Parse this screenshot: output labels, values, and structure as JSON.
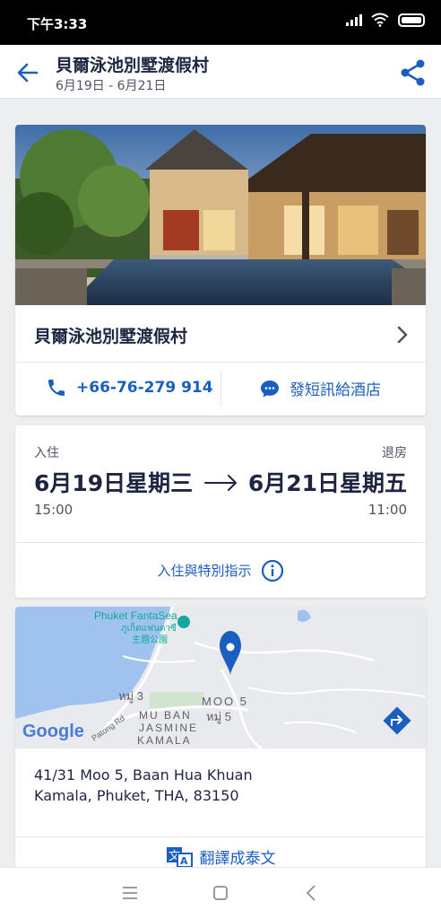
{
  "status_bar": {
    "time": "下午3:33"
  },
  "app_bar": {
    "title": "貝爾泳池別墅渡假村",
    "dates": "6月19日 - 6月21日"
  },
  "hotel": {
    "name": "貝爾泳池別墅渡假村",
    "phone": "+66-76-279 914",
    "sms_label": "發短訊給酒店"
  },
  "stay": {
    "checkin_label": "入住",
    "checkout_label": "退房",
    "checkin_date": "6月19日星期三",
    "checkout_date": "6月21日星期五",
    "checkin_time": "15:00",
    "checkout_time": "11:00",
    "instructions_label": "入住與特別指示"
  },
  "map": {
    "poi_name": "Phuket FantaSea",
    "poi_thai_1": "ภูเก็ตแฟนตาซี",
    "poi_thai_2": "主題公園",
    "label_moo3": "หมู่ 3",
    "label_moo5": "MOO 5",
    "label_moo5_thai": "หมู่ 5",
    "label_muban_1": "MU BAN",
    "label_muban_2": "JASMINE",
    "label_muban_3": "KAMALA",
    "road_label": "Patong Rd",
    "logo_text": "Google"
  },
  "address": {
    "line1": "41/31 Moo 5, Baan Hua Khuan",
    "line2": "Kamala, Phuket, THA, 83150",
    "translate_label": "翻譯成泰文"
  },
  "colors": {
    "accent": "#1a5fc0",
    "text_dark": "#1d2540",
    "background": "#eceef0"
  }
}
